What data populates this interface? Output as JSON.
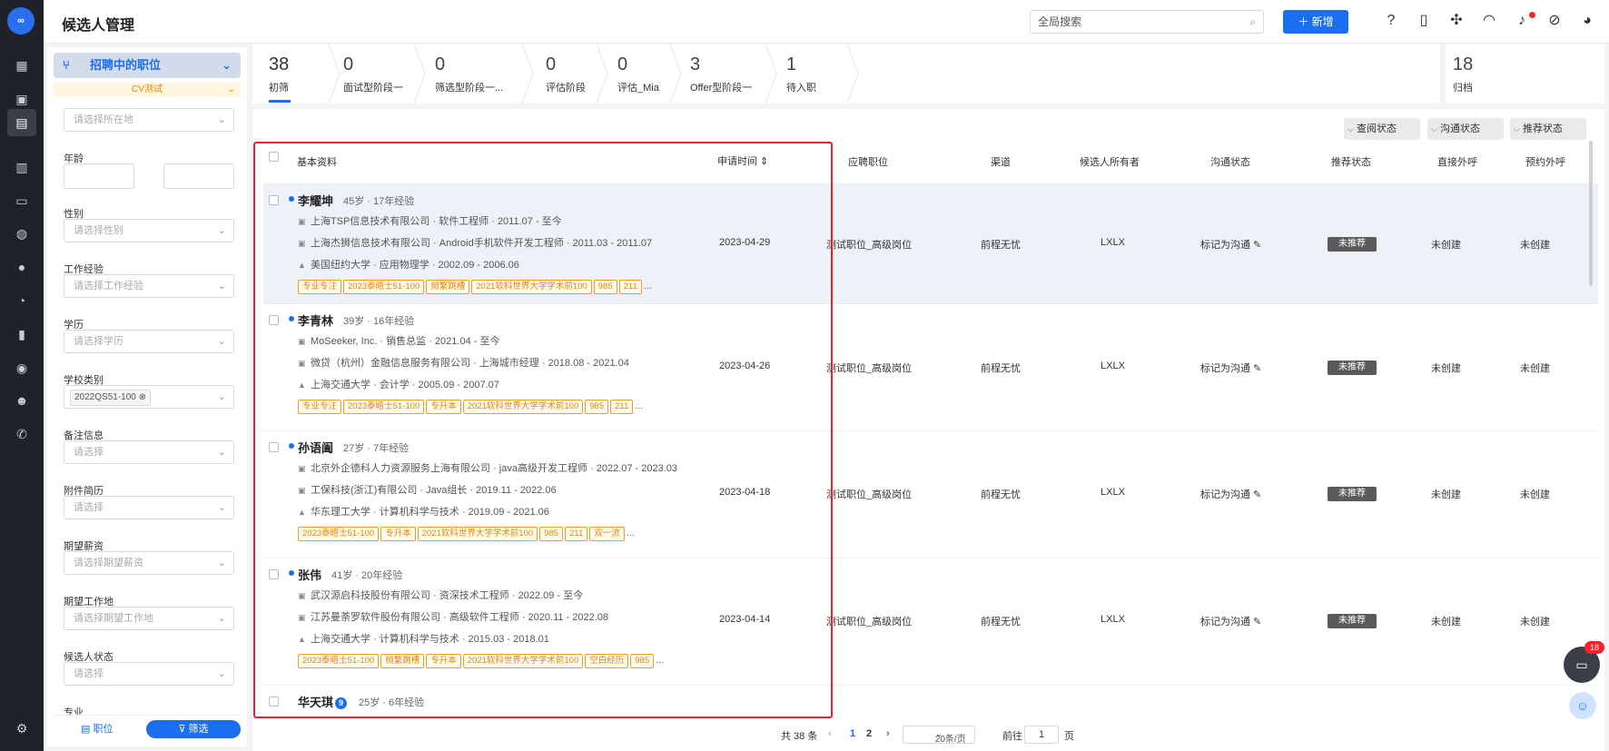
{
  "header": {
    "title": "候选人管理",
    "search_placeholder": "全局搜索",
    "new_label": "＋ 新增"
  },
  "filter": {
    "job_select": "招聘中的职位",
    "cv_tag": "CV测试",
    "location_placeholder": "请选择所在地",
    "age_label": "年龄",
    "age_dash": "-",
    "gender_label": "性别",
    "gender_placeholder": "请选择性别",
    "experience_label": "工作经验",
    "experience_placeholder": "请选择工作经验",
    "education_label": "学历",
    "education_placeholder": "请选择学历",
    "school_label": "学校类别",
    "school_chip": "2022QS51-100 ⊗",
    "notes_label": "备注信息",
    "notes_placeholder": "请选择",
    "attachment_label": "附件简历",
    "attachment_placeholder": "请选择",
    "salary_label": "期望薪资",
    "salary_placeholder": "请选择期望薪资",
    "workplace_label": "期望工作地",
    "workplace_placeholder": "请选择期望工作地",
    "status_label": "候选人状态",
    "status_placeholder": "请选择",
    "major_label": "专业",
    "position_button": "职位",
    "filter_button": "筛选"
  },
  "stages": [
    {
      "count": "38",
      "label": "初筛"
    },
    {
      "count": "0",
      "label": "面试型阶段一"
    },
    {
      "count": "0",
      "label": "筛选型阶段一..."
    },
    {
      "count": "0",
      "label": "评估阶段"
    },
    {
      "count": "0",
      "label": "评估_Mia"
    },
    {
      "count": "3",
      "label": "Offer型阶段一"
    },
    {
      "count": "1",
      "label": "待入职"
    }
  ],
  "archive": {
    "count": "18",
    "label": "归档"
  },
  "status_filters": [
    "查阅状态",
    "沟通状态",
    "推荐状态"
  ],
  "columns": {
    "basic": "基本资料",
    "apply_time": "申请时间 ⇕",
    "position": "应聘职位",
    "channel": "渠道",
    "owner": "候选人所有者",
    "comm_status": "沟通状态",
    "rec_status": "推荐状态",
    "direct_outsource": "直接外呼",
    "booking_outsource": "预约外呼"
  },
  "candidates": [
    {
      "name": "李耀坤",
      "meta": "45岁 · 17年经验",
      "lines": [
        "上海TSP信息技术有限公司  ·  软件工程师  ·  2011.07 - 至今",
        "上海杰狮信息技术有限公司  ·  Android手机软件开发工程师  ·  2011.03 - 2011.07",
        "美国纽约大学  ·  应用物理学  ·  2002.09 - 2006.06"
      ],
      "tags": [
        "专业专注",
        "2023泰晤士51-100",
        "频繁跳槽",
        "2021软科世界大学学术前100",
        "985",
        "211"
      ],
      "apply_time": "2023-04-29",
      "position": "测试职位_高级岗位",
      "channel": "前程无忧",
      "owner": "LXLX",
      "comm": "标记为沟通 ✎",
      "rec": "未推荐",
      "direct": "未创建",
      "booking": "未创建"
    },
    {
      "name": "李青林",
      "meta": "39岁 · 16年经验",
      "lines": [
        "MoSeeker, Inc.  ·  销售总监  ·  2021.04 - 至今",
        "微贷（杭州）金融信息服务有限公司  ·  上海城市经理  ·  2018.08 - 2021.04",
        "上海交通大学  ·  会计学  ·  2005.09 - 2007.07"
      ],
      "tags": [
        "专业专注",
        "2023泰晤士51-100",
        "专升本",
        "2021软科世界大学学术前100",
        "985",
        "211"
      ],
      "apply_time": "2023-04-26",
      "position": "测试职位_高级岗位",
      "channel": "前程无忧",
      "owner": "LXLX",
      "comm": "标记为沟通 ✎",
      "rec": "未推荐",
      "direct": "未创建",
      "booking": "未创建"
    },
    {
      "name": "孙语阖",
      "meta": "27岁 · 7年经验",
      "lines": [
        "北京外企德科人力资源服务上海有限公司  ·  java高级开发工程师  ·  2022.07 - 2023.03",
        "工保科技(浙江)有限公司  ·  Java组长  ·  2019.11 - 2022.06",
        "华东理工大学  ·  计算机科学与技术  ·  2019.09 - 2021.06"
      ],
      "tags": [
        "2023泰晤士51-100",
        "专升本",
        "2021软科世界大学学术前100",
        "985",
        "211",
        "双一流"
      ],
      "apply_time": "2023-04-18",
      "position": "测试职位_高级岗位",
      "channel": "前程无忧",
      "owner": "LXLX",
      "comm": "标记为沟通 ✎",
      "rec": "未推荐",
      "direct": "未创建",
      "booking": "未创建"
    },
    {
      "name": "张伟",
      "meta": "41岁 · 20年经验",
      "lines": [
        "武汉源启科技股份有限公司  ·  资深技术工程师  ·  2022.09 - 至今",
        "江苏曼荼罗软件股份有限公司  ·  高级软件工程师  ·  2020.11 - 2022.08",
        "上海交通大学  ·  计算机科学与技术  ·  2015.03 - 2018.01"
      ],
      "tags": [
        "2023泰晤士51-100",
        "频繁跳槽",
        "专升本",
        "2021软科世界大学学术前100",
        "空白经历",
        "985"
      ],
      "apply_time": "2023-04-14",
      "position": "测试职位_高级岗位",
      "channel": "前程无忧",
      "owner": "LXLX",
      "comm": "标记为沟通 ✎",
      "rec": "未推荐",
      "direct": "未创建",
      "booking": "未创建"
    },
    {
      "name": "华天琪",
      "badge": "9",
      "meta": "25岁 · 6年经验"
    }
  ],
  "more": "...",
  "pager": {
    "total": "共 38 条",
    "prev": "‹",
    "page1": "1",
    "page2": "2",
    "next": "›",
    "page_size": "20条/页",
    "goto": "前往",
    "goto_value": "1",
    "page_unit": "页"
  },
  "chat_badge": "18",
  "colors": {
    "accent": "#1a6ef0",
    "tag": "#e08a00",
    "highlight": "#e8232a"
  }
}
